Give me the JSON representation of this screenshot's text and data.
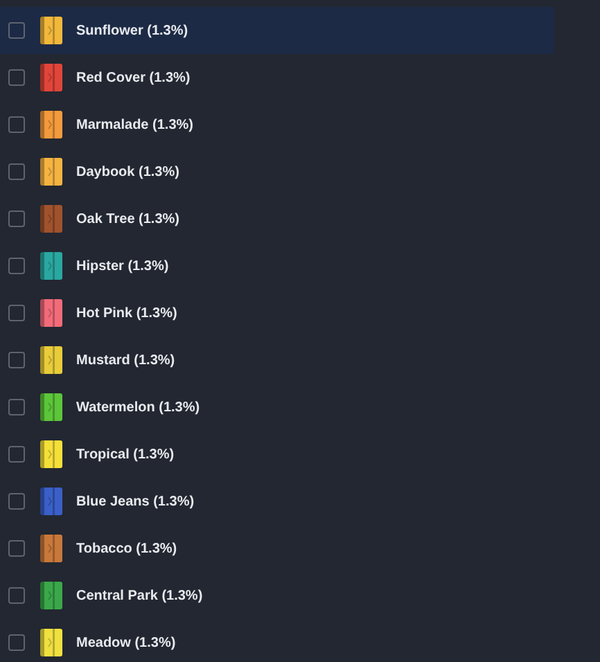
{
  "items": [
    {
      "label": "Sunflower (1.3%)",
      "checked": false,
      "selected": true,
      "color": "#f2b83c"
    },
    {
      "label": "Red Cover (1.3%)",
      "checked": false,
      "selected": false,
      "color": "#e0453a"
    },
    {
      "label": "Marmalade (1.3%)",
      "checked": false,
      "selected": false,
      "color": "#f39a3c"
    },
    {
      "label": "Daybook (1.3%)",
      "checked": false,
      "selected": false,
      "color": "#f5b441"
    },
    {
      "label": "Oak Tree (1.3%)",
      "checked": false,
      "selected": false,
      "color": "#a0522d"
    },
    {
      "label": "Hipster (1.3%)",
      "checked": false,
      "selected": false,
      "color": "#2aa7a0"
    },
    {
      "label": "Hot Pink (1.3%)",
      "checked": false,
      "selected": false,
      "color": "#f26b7a"
    },
    {
      "label": "Mustard (1.3%)",
      "checked": false,
      "selected": false,
      "color": "#e8cc3a"
    },
    {
      "label": "Watermelon (1.3%)",
      "checked": false,
      "selected": false,
      "color": "#5cc53a"
    },
    {
      "label": "Tropical (1.3%)",
      "checked": false,
      "selected": false,
      "color": "#f5e03a"
    },
    {
      "label": "Blue Jeans (1.3%)",
      "checked": false,
      "selected": false,
      "color": "#3a5fc8"
    },
    {
      "label": "Tobacco (1.3%)",
      "checked": false,
      "selected": false,
      "color": "#c8783a"
    },
    {
      "label": "Central Park (1.3%)",
      "checked": false,
      "selected": false,
      "color": "#3aa84a"
    },
    {
      "label": "Meadow (1.3%)",
      "checked": false,
      "selected": false,
      "color": "#f0e040"
    }
  ]
}
